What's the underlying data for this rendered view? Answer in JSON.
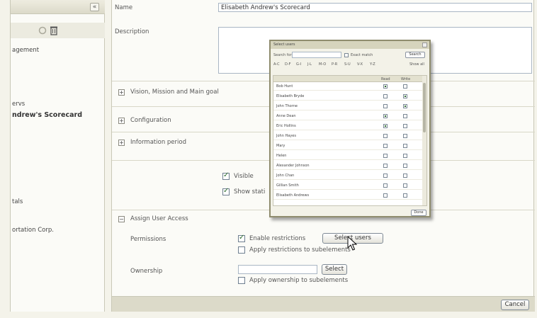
{
  "sidebar": {
    "collapse_glyph": "«",
    "items": [
      {
        "text": "agement"
      },
      {
        "text": "ervs"
      },
      {
        "text": "ndrew's Scorecard"
      },
      {
        "text": "tals"
      },
      {
        "text": "ortation Corp."
      }
    ]
  },
  "form": {
    "name_label": "Name",
    "name_value": "Elisabeth Andrew's Scorecard",
    "description_label": "Description",
    "sections": {
      "vision": "Vision, Mission and Main goal",
      "configuration": "Configuration",
      "information_period": "Information period",
      "assign_access": "Assign User Access"
    },
    "visible_label": "Visible",
    "show_label": "Show stati",
    "permissions_label": "Permissions",
    "enable_restrictions": "Enable restrictions",
    "select_users_button": "Select users",
    "apply_restrictions": "Apply restrictions to subelements",
    "ownership_label": "Ownership",
    "select_button": "Select",
    "apply_ownership": "Apply ownership to subelements",
    "cancel_button": "Cancel"
  },
  "popup": {
    "title": "Select users",
    "search_label": "Search for",
    "exact_match": "Exact match",
    "search_button": "Search",
    "letter_filters": [
      "A-C",
      "D-F",
      "G-I",
      "J-L",
      "M-O",
      "P-R",
      "S-U",
      "V-X",
      "Y-Z",
      "Show all"
    ],
    "col_read": "Read",
    "col_write": "Write",
    "users": [
      {
        "name": "Bob Hunt",
        "read": true,
        "write": false
      },
      {
        "name": "Elisabeth Bryde",
        "read": false,
        "write": true
      },
      {
        "name": "John Thorne",
        "read": false,
        "write": true
      },
      {
        "name": "Anne Dean",
        "read": true,
        "write": false
      },
      {
        "name": "Eric Hollins",
        "read": true,
        "write": false
      },
      {
        "name": "John Hayes",
        "read": false,
        "write": false
      },
      {
        "name": "Mary",
        "read": false,
        "write": false
      },
      {
        "name": "Helen",
        "read": false,
        "write": false
      },
      {
        "name": "Alexander Johnson",
        "read": false,
        "write": false
      },
      {
        "name": "John Chan",
        "read": false,
        "write": false
      },
      {
        "name": "Gillian Smith",
        "read": false,
        "write": false
      },
      {
        "name": "Elisabeth Andrews",
        "read": false,
        "write": false
      }
    ],
    "done_button": "Done"
  }
}
